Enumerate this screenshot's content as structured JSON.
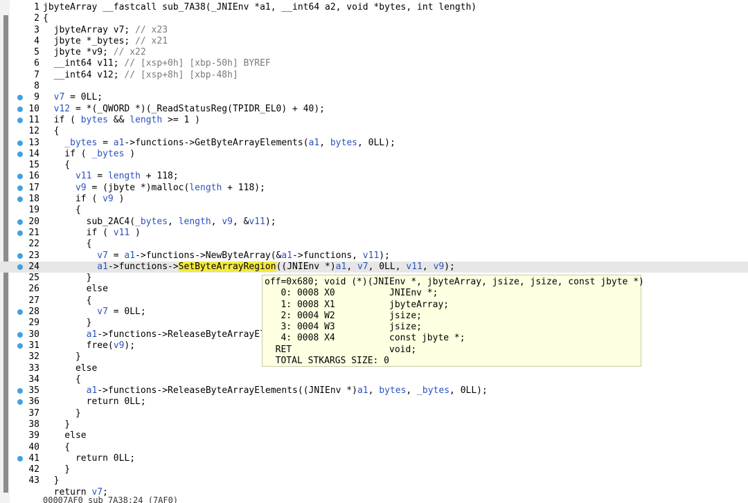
{
  "editor": {
    "lines": [
      {
        "n": "1",
        "bp": false,
        "segs": [
          [
            "dk",
            "jbyteArray __fastcall sub_7A38(_JNIEnv *a1, __int64 a2, void *bytes, int length)"
          ]
        ]
      },
      {
        "n": "2",
        "bp": false,
        "segs": [
          [
            "dk",
            "{"
          ]
        ]
      },
      {
        "n": "3",
        "bp": false,
        "segs": [
          [
            "dk",
            "  jbyteArray v7; "
          ],
          [
            "gy",
            "// x23"
          ]
        ]
      },
      {
        "n": "4",
        "bp": false,
        "segs": [
          [
            "dk",
            "  jbyte *_bytes; "
          ],
          [
            "gy",
            "// x21"
          ]
        ]
      },
      {
        "n": "5",
        "bp": false,
        "segs": [
          [
            "dk",
            "  jbyte *v9; "
          ],
          [
            "gy",
            "// x22"
          ]
        ]
      },
      {
        "n": "6",
        "bp": false,
        "segs": [
          [
            "dk",
            "  __int64 v11; "
          ],
          [
            "gy",
            "// [xsp+0h] [xbp-50h] BYREF"
          ]
        ]
      },
      {
        "n": "7",
        "bp": false,
        "segs": [
          [
            "dk",
            "  __int64 v12; "
          ],
          [
            "gy",
            "// [xsp+8h] [xbp-48h]"
          ]
        ]
      },
      {
        "n": "8",
        "bp": false,
        "segs": [
          [
            "dk",
            ""
          ]
        ]
      },
      {
        "n": "9",
        "bp": true,
        "segs": [
          [
            "vr",
            "  v7"
          ],
          [
            "dk",
            " = 0LL;"
          ]
        ]
      },
      {
        "n": "10",
        "bp": true,
        "segs": [
          [
            "vr",
            "  v12"
          ],
          [
            "dk",
            " = *(_QWORD *)(_ReadStatusReg(TPIDR_EL0) + 40);"
          ]
        ]
      },
      {
        "n": "11",
        "bp": true,
        "segs": [
          [
            "dk",
            "  if ( "
          ],
          [
            "vr",
            "bytes"
          ],
          [
            "dk",
            " && "
          ],
          [
            "vr",
            "length"
          ],
          [
            "dk",
            " >= 1 )"
          ]
        ]
      },
      {
        "n": "12",
        "bp": false,
        "segs": [
          [
            "dk",
            "  {"
          ]
        ]
      },
      {
        "n": "13",
        "bp": true,
        "segs": [
          [
            "vr",
            "    _bytes"
          ],
          [
            "dk",
            " = "
          ],
          [
            "vr",
            "a1"
          ],
          [
            "dk",
            "->functions->GetByteArrayElements("
          ],
          [
            "vr",
            "a1"
          ],
          [
            "dk",
            ", "
          ],
          [
            "vr",
            "bytes"
          ],
          [
            "dk",
            ", 0LL);"
          ]
        ]
      },
      {
        "n": "14",
        "bp": true,
        "segs": [
          [
            "dk",
            "    if ( "
          ],
          [
            "vr",
            "_bytes"
          ],
          [
            "dk",
            " )"
          ]
        ]
      },
      {
        "n": "15",
        "bp": false,
        "segs": [
          [
            "dk",
            "    {"
          ]
        ]
      },
      {
        "n": "16",
        "bp": true,
        "segs": [
          [
            "vr",
            "      v11"
          ],
          [
            "dk",
            " = "
          ],
          [
            "vr",
            "length"
          ],
          [
            "dk",
            " + 118;"
          ]
        ]
      },
      {
        "n": "17",
        "bp": true,
        "segs": [
          [
            "vr",
            "      v9"
          ],
          [
            "dk",
            " = (jbyte *)malloc("
          ],
          [
            "vr",
            "length"
          ],
          [
            "dk",
            " + 118);"
          ]
        ]
      },
      {
        "n": "18",
        "bp": true,
        "segs": [
          [
            "dk",
            "      if ( "
          ],
          [
            "vr",
            "v9"
          ],
          [
            "dk",
            " )"
          ]
        ]
      },
      {
        "n": "19",
        "bp": false,
        "segs": [
          [
            "dk",
            "      {"
          ]
        ]
      },
      {
        "n": "20",
        "bp": true,
        "segs": [
          [
            "dk",
            "        sub_2AC4("
          ],
          [
            "vr",
            "_bytes"
          ],
          [
            "dk",
            ", "
          ],
          [
            "vr",
            "length"
          ],
          [
            "dk",
            ", "
          ],
          [
            "vr",
            "v9"
          ],
          [
            "dk",
            ", &"
          ],
          [
            "vr",
            "v11"
          ],
          [
            "dk",
            ");"
          ]
        ]
      },
      {
        "n": "21",
        "bp": true,
        "segs": [
          [
            "dk",
            "        if ( "
          ],
          [
            "vr",
            "v11"
          ],
          [
            "dk",
            " )"
          ]
        ]
      },
      {
        "n": "22",
        "bp": false,
        "segs": [
          [
            "dk",
            "        {"
          ]
        ]
      },
      {
        "n": "23",
        "bp": true,
        "segs": [
          [
            "vr",
            "          v7"
          ],
          [
            "dk",
            " = "
          ],
          [
            "vr",
            "a1"
          ],
          [
            "dk",
            "->functions->NewByteArray(&"
          ],
          [
            "vr",
            "a1"
          ],
          [
            "dk",
            "->functions, "
          ],
          [
            "vr",
            "v11"
          ],
          [
            "dk",
            ");"
          ]
        ]
      },
      {
        "n": "24",
        "bp": true,
        "current": true,
        "segs": [
          [
            "vr",
            "          a1"
          ],
          [
            "dk",
            "->functions->"
          ],
          [
            "hl",
            "SetByteArrayRegion"
          ],
          [
            "dk",
            "((JNIEnv *)"
          ],
          [
            "vr",
            "a1"
          ],
          [
            "dk",
            ", "
          ],
          [
            "vr",
            "v7"
          ],
          [
            "dk",
            ", 0LL, "
          ],
          [
            "vr",
            "v11"
          ],
          [
            "dk",
            ", "
          ],
          [
            "vr",
            "v9"
          ],
          [
            "dk",
            ");"
          ]
        ]
      },
      {
        "n": "25",
        "bp": false,
        "segs": [
          [
            "dk",
            "        }"
          ]
        ]
      },
      {
        "n": "26",
        "bp": false,
        "segs": [
          [
            "dk",
            "        else"
          ]
        ]
      },
      {
        "n": "27",
        "bp": false,
        "segs": [
          [
            "dk",
            "        {"
          ]
        ]
      },
      {
        "n": "28",
        "bp": true,
        "segs": [
          [
            "vr",
            "          v7"
          ],
          [
            "dk",
            " = 0LL;"
          ]
        ]
      },
      {
        "n": "29",
        "bp": false,
        "segs": [
          [
            "dk",
            "        }"
          ]
        ]
      },
      {
        "n": "30",
        "bp": true,
        "segs": [
          [
            "vr",
            "        a1"
          ],
          [
            "dk",
            "->functions->ReleaseByteArrayEl"
          ]
        ]
      },
      {
        "n": "31",
        "bp": true,
        "segs": [
          [
            "dk",
            "        free("
          ],
          [
            "vr",
            "v9"
          ],
          [
            "dk",
            ");"
          ]
        ]
      },
      {
        "n": "32",
        "bp": false,
        "segs": [
          [
            "dk",
            "      }"
          ]
        ]
      },
      {
        "n": "33",
        "bp": false,
        "segs": [
          [
            "dk",
            "      else"
          ]
        ]
      },
      {
        "n": "34",
        "bp": false,
        "segs": [
          [
            "dk",
            "      {"
          ]
        ]
      },
      {
        "n": "35",
        "bp": true,
        "segs": [
          [
            "vr",
            "        a1"
          ],
          [
            "dk",
            "->functions->ReleaseByteArrayElements((JNIEnv *)"
          ],
          [
            "vr",
            "a1"
          ],
          [
            "dk",
            ", "
          ],
          [
            "vr",
            "bytes"
          ],
          [
            "dk",
            ", "
          ],
          [
            "vr",
            "_bytes"
          ],
          [
            "dk",
            ", 0LL);"
          ]
        ]
      },
      {
        "n": "36",
        "bp": true,
        "segs": [
          [
            "dk",
            "        return 0LL;"
          ]
        ]
      },
      {
        "n": "37",
        "bp": false,
        "segs": [
          [
            "dk",
            "      }"
          ]
        ]
      },
      {
        "n": "38",
        "bp": false,
        "segs": [
          [
            "dk",
            "    }"
          ]
        ]
      },
      {
        "n": "39",
        "bp": false,
        "segs": [
          [
            "dk",
            "    else"
          ]
        ]
      },
      {
        "n": "40",
        "bp": false,
        "segs": [
          [
            "dk",
            "    {"
          ]
        ]
      },
      {
        "n": "41",
        "bp": true,
        "segs": [
          [
            "dk",
            "      return 0LL;"
          ]
        ]
      },
      {
        "n": "42",
        "bp": false,
        "segs": [
          [
            "dk",
            "    }"
          ]
        ]
      },
      {
        "n": "43",
        "bp": false,
        "segs": [
          [
            "dk",
            "  }"
          ]
        ]
      },
      {
        "n": "",
        "bp": false,
        "segs": [
          [
            "dk",
            "  return "
          ],
          [
            "vr",
            "v7"
          ],
          [
            "dk",
            ";"
          ]
        ]
      }
    ]
  },
  "tooltip": {
    "lines": [
      "off=0x680; void (*)(JNIEnv *, jbyteArray, jsize, jsize, const jbyte *)",
      "   0: 0008 X0          JNIEnv *;",
      "   1: 0008 X1          jbyteArray;",
      "   2: 0004 W2          jsize;",
      "   3: 0004 W3          jsize;",
      "   4: 0008 X4          const jbyte *;",
      "  RET                  void;",
      "  TOTAL STKARGS SIZE: 0"
    ]
  },
  "status": {
    "text": "00007AF0 sub_7A38:24 (7AF0)"
  }
}
